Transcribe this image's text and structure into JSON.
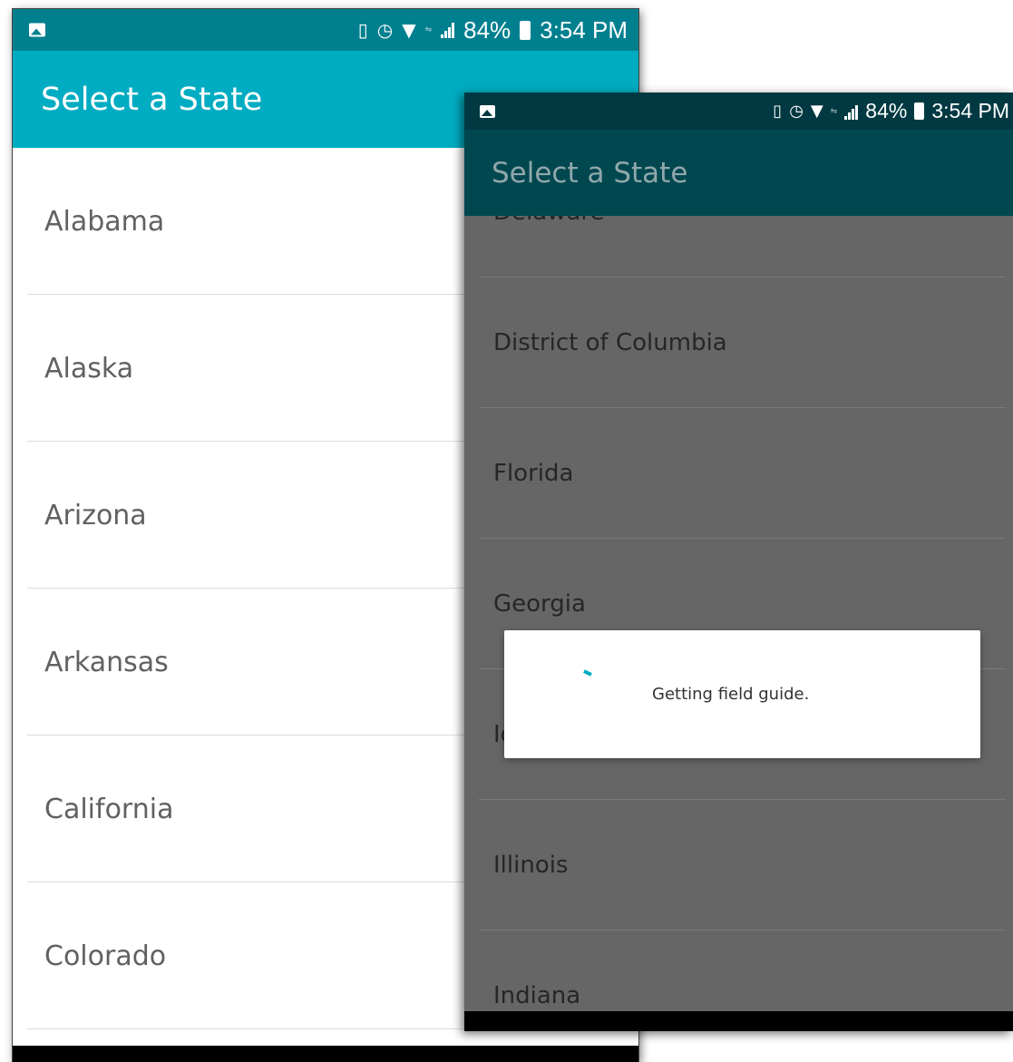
{
  "status_bar": {
    "battery": "84%",
    "time": "3:54 PM",
    "icons": [
      "image-icon",
      "vibrate-icon",
      "alarm-icon",
      "wifi-icon",
      "data-icon",
      "signal-icon",
      "battery-icon"
    ]
  },
  "screen1": {
    "title": "Select a State",
    "states": [
      "Alabama",
      "Alaska",
      "Arizona",
      "Arkansas",
      "California",
      "Colorado"
    ]
  },
  "screen2": {
    "title": "Select a State",
    "states": [
      "Delaware",
      "District of Columbia",
      "Florida",
      "Georgia",
      "Idaho",
      "Illinois",
      "Indiana"
    ],
    "dialog": {
      "message": "Getting field guide."
    }
  },
  "colors": {
    "app_bar": "#00acc1",
    "status_bar": "#00808f",
    "dimmed_app_bar": "#004750",
    "dimmed_status_bar": "#003942",
    "spinner": "#00acc1",
    "list_text": "#616161"
  }
}
